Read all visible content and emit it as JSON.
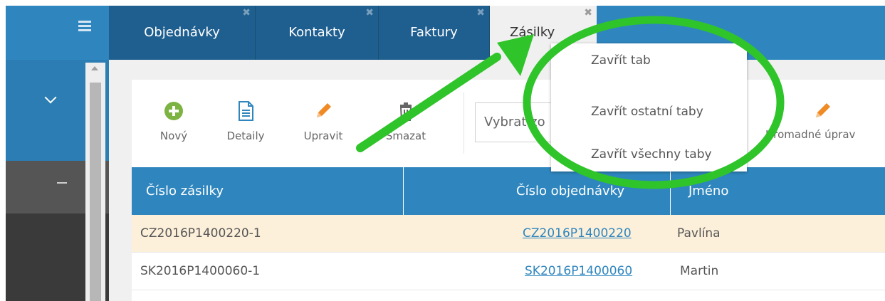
{
  "tabs": [
    {
      "label": "Objednávky"
    },
    {
      "label": "Kontakty"
    },
    {
      "label": "Faktury"
    },
    {
      "label": "Zásilky"
    }
  ],
  "toolbar": {
    "new_label": "Nový",
    "details_label": "Detaily",
    "edit_label": "Upravit",
    "delete_label": "Smazat",
    "select_placeholder": "Vybrat zo",
    "bulk_edit_label": "Hromadné úprav"
  },
  "context_menu": {
    "items": [
      {
        "label": "Zavřít tab"
      },
      {
        "label": "Zavřít ostatní taby"
      },
      {
        "label": "Zavřít všechny taby"
      }
    ]
  },
  "table": {
    "columns": [
      "Číslo zásilky",
      "Číslo objednávky",
      "Jméno"
    ],
    "rows": [
      {
        "shipment": "CZ2016P1400220-1",
        "order": "CZ2016P1400220",
        "name": "Pavlína",
        "selected": true
      },
      {
        "shipment": "SK2016P1400060-1",
        "order": "SK2016P1400060",
        "name": "Martin",
        "selected": false
      }
    ]
  },
  "colors": {
    "accent": "#2f86be",
    "tab_inactive": "#1f5f8f",
    "selected_row": "#fdf0da",
    "annotation": "#2fc42a"
  },
  "icons": {
    "menu": "hamburger-icon",
    "expand": "chevron-down-icon",
    "collapse": "minus-icon",
    "new": "plus-circle-icon",
    "details": "document-icon",
    "edit": "pencil-icon",
    "delete": "trash-icon"
  }
}
